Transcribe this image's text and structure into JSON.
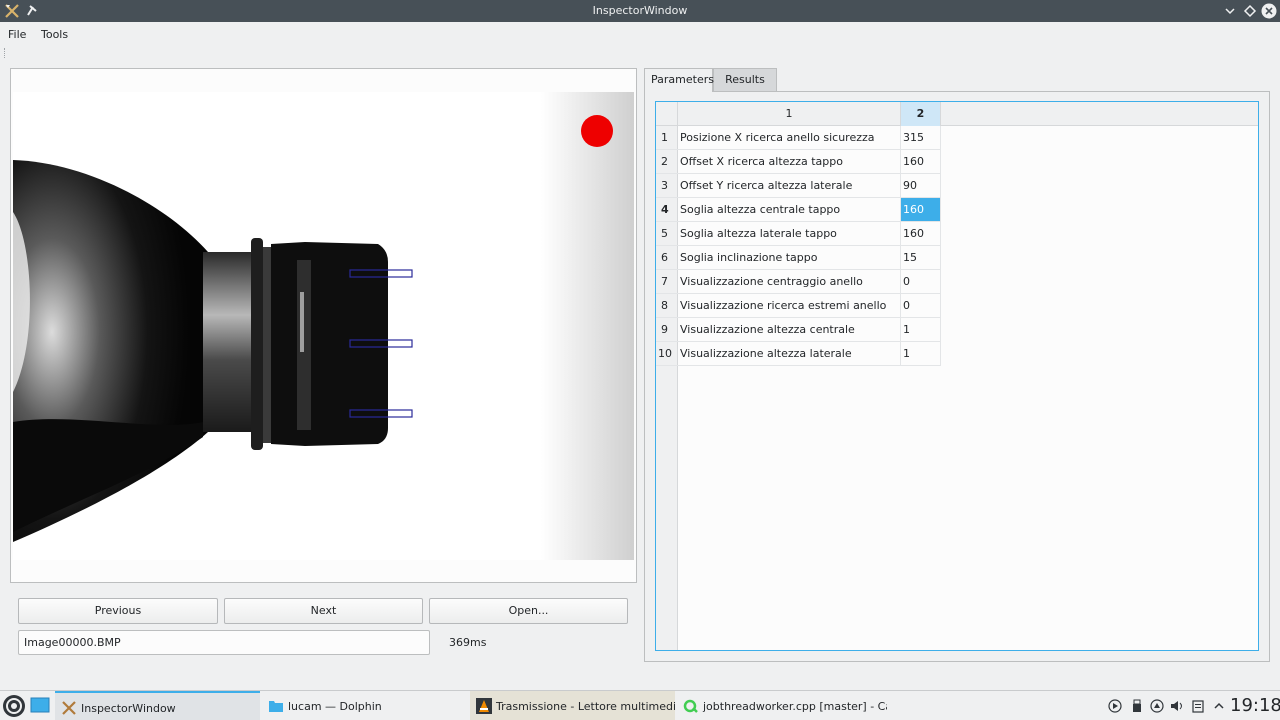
{
  "window": {
    "title": "InspectorWindow"
  },
  "menu": {
    "file": "File",
    "tools": "Tools"
  },
  "viewer": {
    "prev_label": "Previous",
    "next_label": "Next",
    "open_label": "Open...",
    "filename": "Image00000.BMP",
    "timing": "369ms"
  },
  "tabs": {
    "parameters": "Parameters",
    "results": "Results"
  },
  "table": {
    "col1": "1",
    "col2": "2",
    "selected_row": 4,
    "rows": [
      {
        "num": "1",
        "name": "Posizione X ricerca anello sicurezza",
        "value": "315"
      },
      {
        "num": "2",
        "name": "Offset X ricerca altezza tappo",
        "value": "160"
      },
      {
        "num": "3",
        "name": "Offset Y ricerca altezza laterale",
        "value": "90"
      },
      {
        "num": "4",
        "name": "Soglia altezza centrale tappo",
        "value": "160"
      },
      {
        "num": "5",
        "name": "Soglia altezza laterale tappo",
        "value": "160"
      },
      {
        "num": "6",
        "name": "Soglia inclinazione tappo",
        "value": "15"
      },
      {
        "num": "7",
        "name": "Visualizzazione centraggio anello",
        "value": "0"
      },
      {
        "num": "8",
        "name": "Visualizzazione ricerca estremi anello",
        "value": "0"
      },
      {
        "num": "9",
        "name": "Visualizzazione altezza centrale",
        "value": "1"
      },
      {
        "num": "10",
        "name": "Visualizzazione altezza laterale",
        "value": "1"
      }
    ]
  },
  "taskbar": {
    "tasks": [
      {
        "label": "InspectorWindow",
        "icon": "inspector-app-icon"
      },
      {
        "label": "lucam — Dolphin",
        "icon": "folder-icon"
      },
      {
        "label": "Trasmissione - Lettore multimedia...",
        "icon": "vlc-icon"
      },
      {
        "label": "jobthreadworker.cpp [master] - Ca...",
        "icon": "qt-creator-icon"
      }
    ],
    "clock": "19:18"
  },
  "colors": {
    "accent": "#3daee9",
    "titlebar": "#475057",
    "status_dot": "#ee0000"
  }
}
